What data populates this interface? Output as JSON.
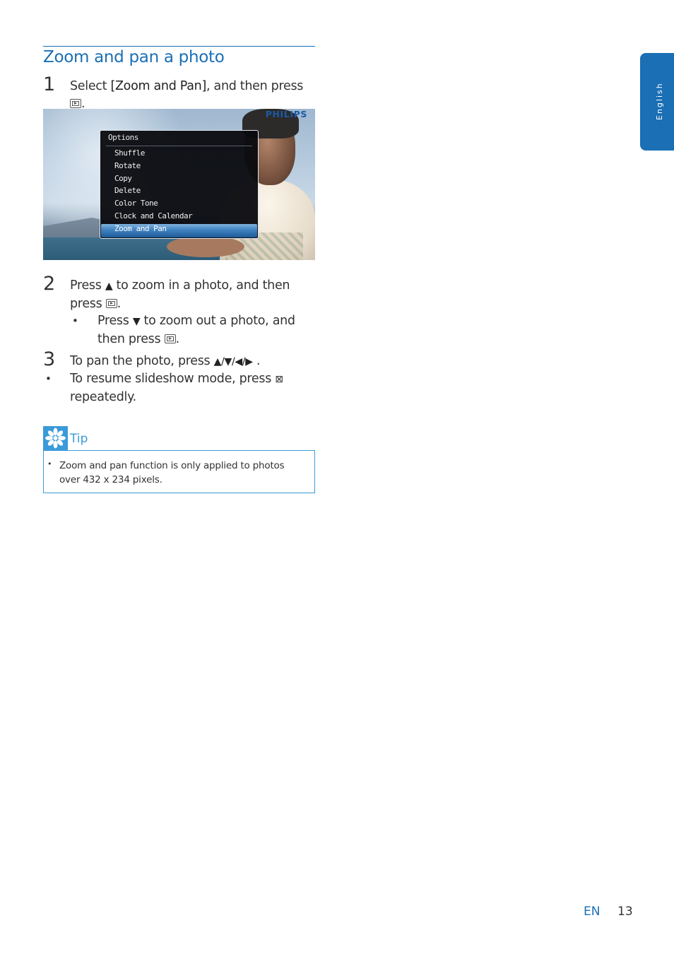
{
  "heading": "Zoom and pan a photo",
  "step1": {
    "number": "1",
    "text_pre": "Select ",
    "text_bold": "[Zoom and Pan]",
    "text_post": ", and then press ",
    "text_end": "."
  },
  "screenshot": {
    "brand": "PHILIPS",
    "menu_title": "Options",
    "menu_items": [
      "Shuffle",
      "Rotate",
      "Copy",
      "Delete",
      "Color Tone",
      "Clock and Calendar",
      "Zoom and Pan"
    ],
    "selected_item": "Zoom and Pan"
  },
  "step2": {
    "number": "2",
    "line1_pre": "Press ",
    "line1_post": " to zoom in a photo, and then",
    "line2_pre": "press ",
    "line2_post": ".",
    "sub_bullet": {
      "line1_pre": "Press ",
      "line1_post": " to zoom out a photo, and",
      "line2_pre": "then press ",
      "line2_post": "."
    }
  },
  "step3": {
    "number": "3",
    "text_pre": "To pan the photo, press ",
    "arrows": "▲/▼/◀/▶",
    "text_post": " ."
  },
  "resume_bullet": {
    "line1": "To resume slideshow mode, press ",
    "line2": "repeatedly."
  },
  "tip": {
    "label": "Tip",
    "items": [
      "Zoom and pan function is only applied to photos over 432 x 234 pixels."
    ]
  },
  "side_tab": {
    "label": "English",
    "color": "#1a6fb5"
  },
  "footer": {
    "lang": "EN",
    "page": "13"
  },
  "colors": {
    "accent": "#1a6fb5",
    "tip": "#3b9ad9"
  }
}
